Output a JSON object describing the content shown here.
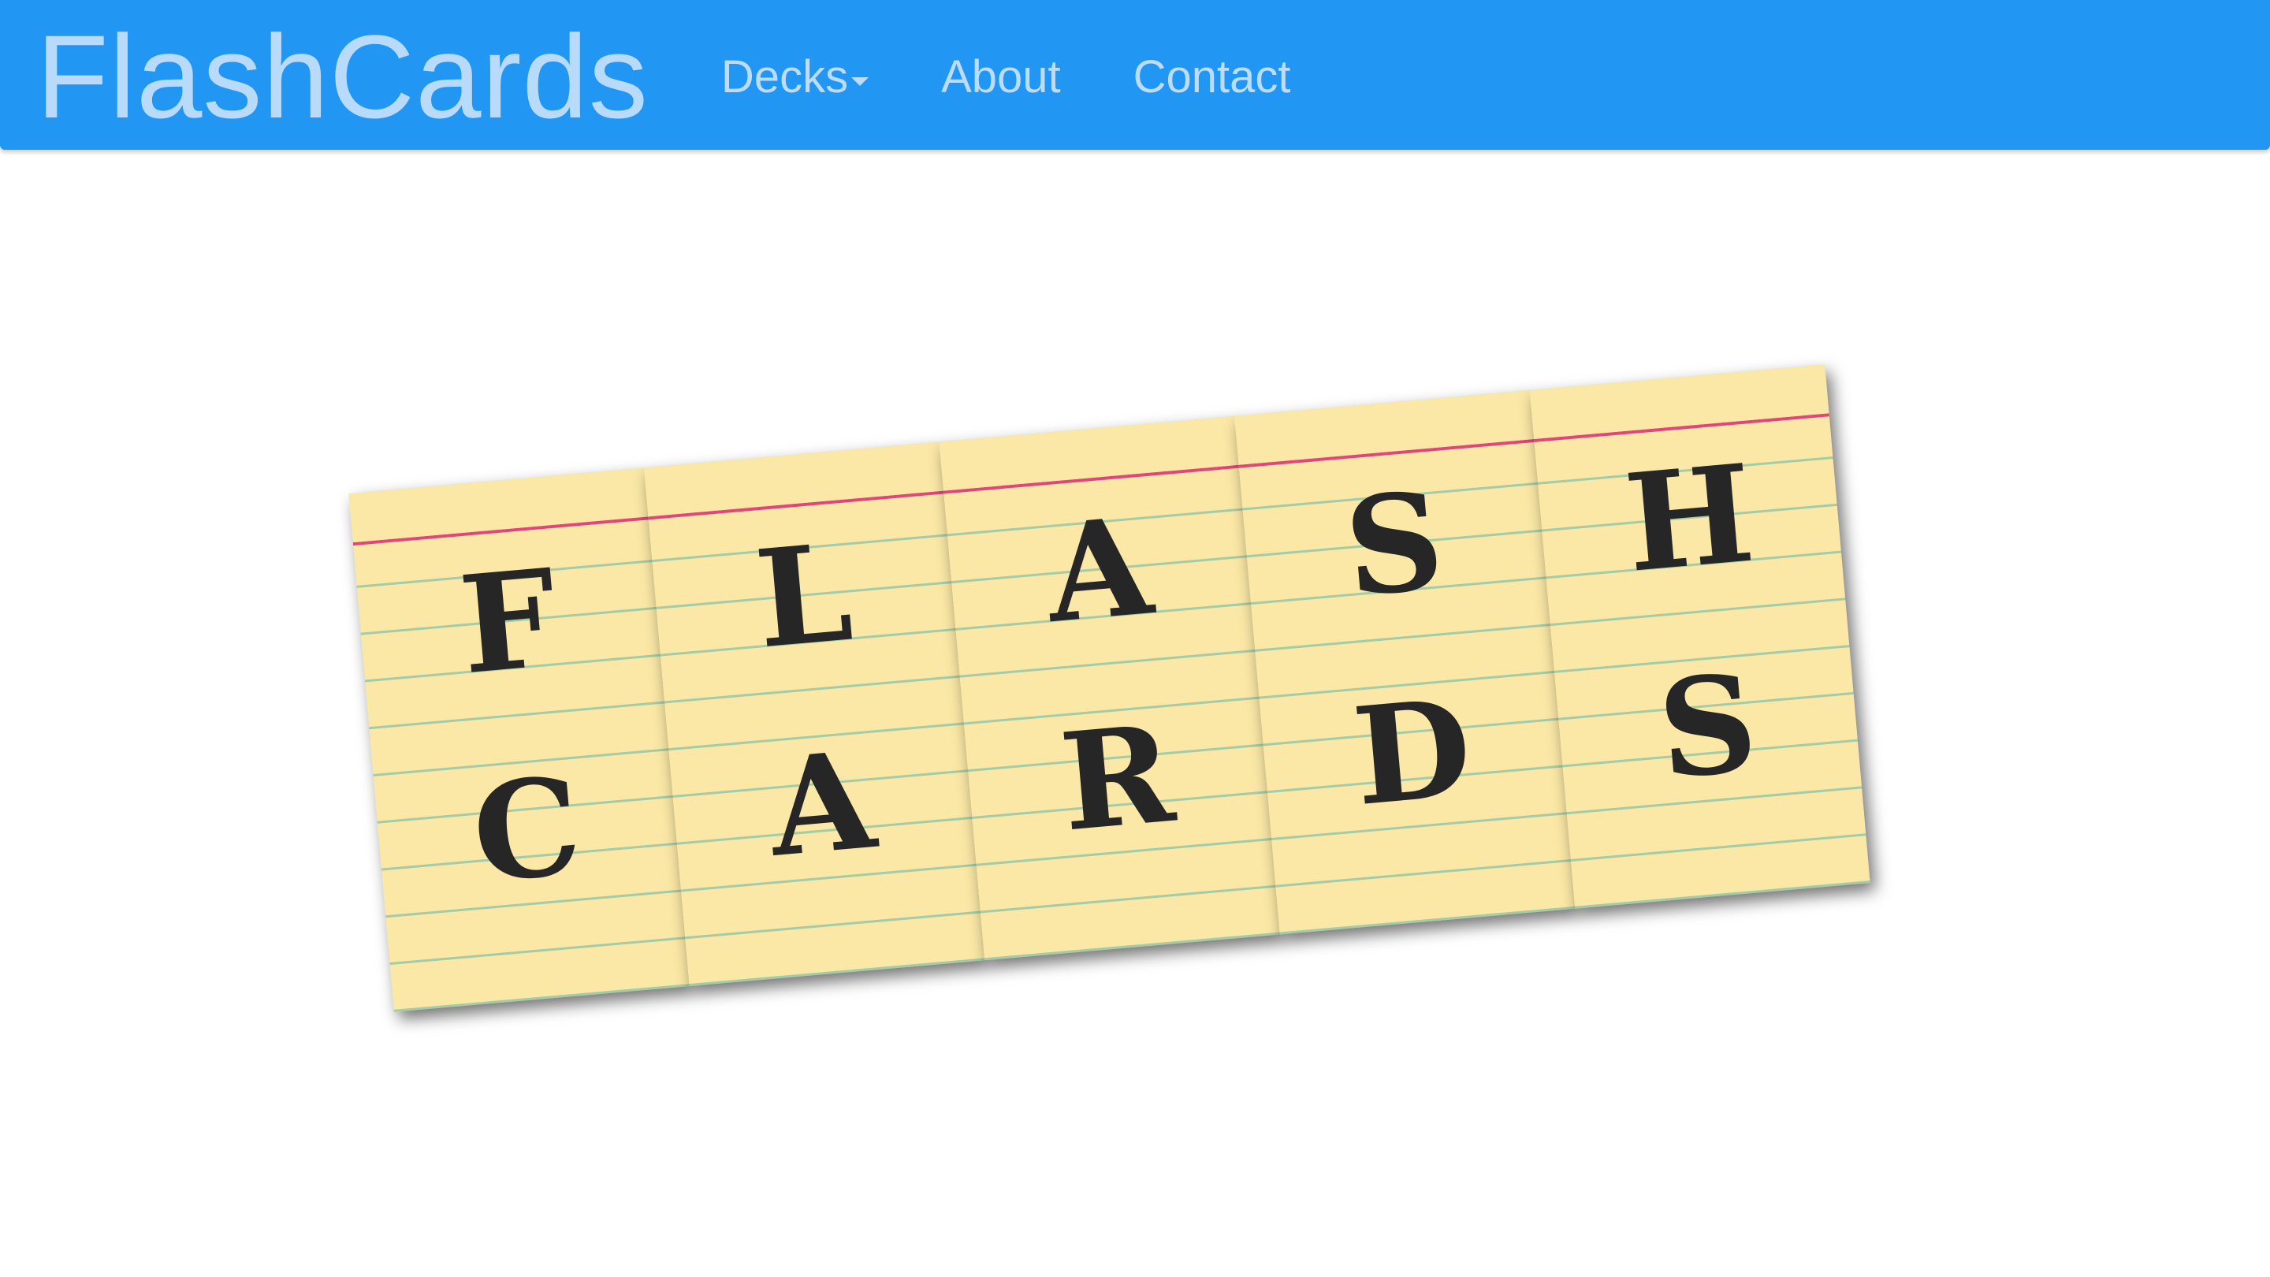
{
  "navbar": {
    "brand": "FlashCards",
    "links": [
      {
        "label": "Decks",
        "has_dropdown": true
      },
      {
        "label": "About",
        "has_dropdown": false
      },
      {
        "label": "Contact",
        "has_dropdown": false
      }
    ],
    "background_color": "#2196f3",
    "text_color": "#bcdcfa"
  },
  "hero": {
    "cards": [
      {
        "top": "F",
        "bottom": "C"
      },
      {
        "top": "L",
        "bottom": "A"
      },
      {
        "top": "A",
        "bottom": "R"
      },
      {
        "top": "S",
        "bottom": "D"
      },
      {
        "top": "H",
        "bottom": "S"
      }
    ],
    "card_color": "#fbe8a6"
  }
}
